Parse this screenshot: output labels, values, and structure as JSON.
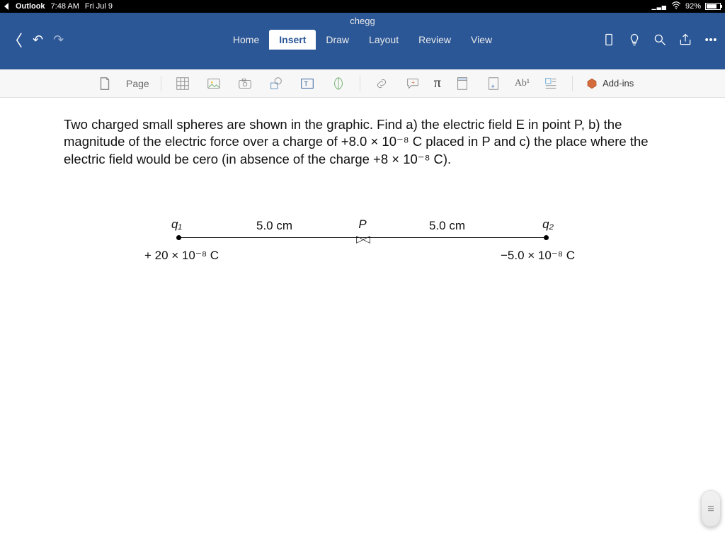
{
  "status": {
    "back_app": "Outlook",
    "time": "7:48 AM",
    "date": "Fri Jul 9",
    "battery_pct": "92%"
  },
  "header": {
    "title": "chegg",
    "tabs": [
      "Home",
      "Insert",
      "Draw",
      "Layout",
      "Review",
      "View"
    ],
    "active_tab": "Insert"
  },
  "ribbon": {
    "page_label": "Page",
    "footnote_label": "Ab¹",
    "equation_label": "π",
    "addins_label": "Add-ins"
  },
  "document": {
    "paragraph": "Two charged small spheres are shown in the graphic. Find a) the electric field E in point P, b) the magnitude of the electric force over a charge of +8.0 × 10⁻⁸ C placed in P and c) the place where the electric field would be cero (in absence of the charge +8 × 10⁻⁸ C).",
    "diagram": {
      "q1_label": "q₁",
      "q2_label": "q₂",
      "P_label": "P",
      "dist_left": "5.0 cm",
      "dist_right": "5.0 cm",
      "charge_left": "+ 20 × 10⁻⁸ C",
      "charge_right": "−5.0 × 10⁻⁸ C"
    }
  }
}
